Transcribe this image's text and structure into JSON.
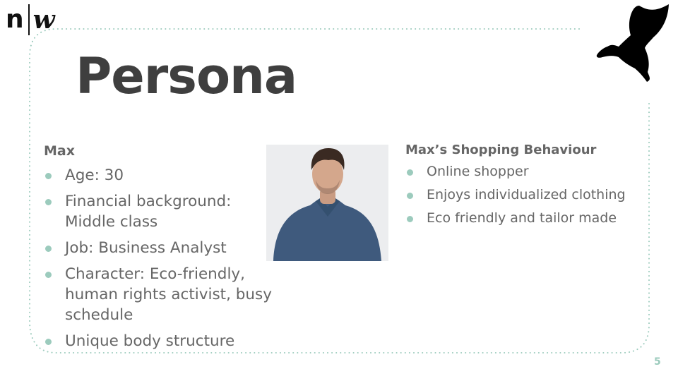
{
  "slide": {
    "title": "Persona",
    "page_number": "5",
    "accent_color": "#9ccbbd"
  },
  "logo": {
    "left_text": "n",
    "right_text": "w"
  },
  "persona": {
    "name": "Max",
    "items": [
      {
        "text": "Age: 30"
      },
      {
        "text": "Financial background: Middle class"
      },
      {
        "text": "Job: Business Analyst"
      },
      {
        "text": "Character: Eco-friendly, human rights activist, busy schedule"
      },
      {
        "text": "Unique body structure"
      }
    ]
  },
  "shopping": {
    "heading": "Max’s Shopping Behaviour",
    "items": [
      {
        "text": "Online shopper"
      },
      {
        "text": "Enjoys individualized clothing"
      },
      {
        "text": "Eco friendly and tailor made"
      }
    ]
  }
}
